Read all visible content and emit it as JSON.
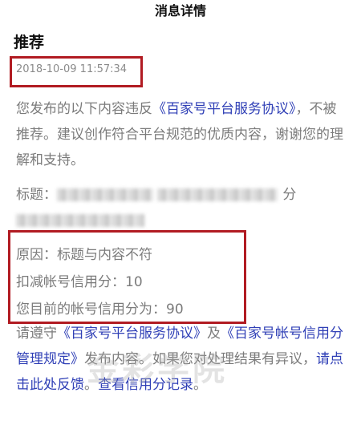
{
  "header": {
    "title": "消息详情"
  },
  "message": {
    "heading": "推荐",
    "timestamp": "2018-10-09 11:57:34",
    "intro_prefix": "您发布的以下内容违反",
    "intro_link": "《百家号平台服务协议》",
    "intro_suffix": "，不被推荐。建议创作符合平台规范的优质内容，谢谢您的理解和支持。",
    "title_label": "标题：",
    "title_tail": "分",
    "reason": "原因：标题与内容不符",
    "deduction": "扣减帐号信用分：10",
    "current_score": "您目前的帐号信用分为：90",
    "notice_prefix": "请遵守",
    "notice_link1": "《百家号平台服务协议》",
    "notice_and": "及",
    "notice_link2": "《百家号帐号信用分管理规定》",
    "notice_mid": "发布内容。如果您对处理结果有异议，",
    "feedback_link": "请点击此处反馈",
    "sep": "。",
    "credit_link": "查看信用分记录",
    "end": "。"
  },
  "watermark": "金彩学院",
  "colors": {
    "link": "#2f3fb6",
    "highlight_border": "#b11b22",
    "text": "#7b7b7b"
  }
}
